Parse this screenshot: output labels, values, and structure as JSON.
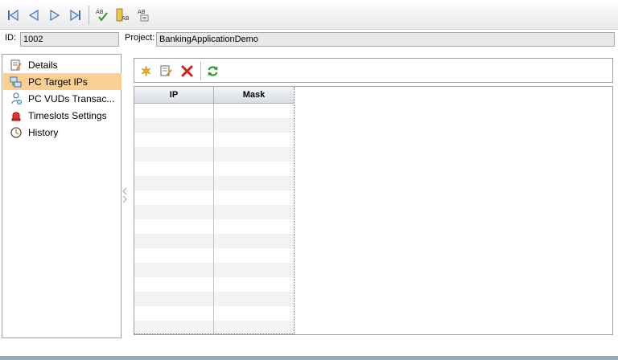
{
  "toolbar": {
    "buttons": [
      {
        "name": "first-record-button",
        "icon": "first-record-icon"
      },
      {
        "name": "previous-record-button",
        "icon": "previous-record-icon"
      },
      {
        "name": "next-record-button",
        "icon": "next-record-icon"
      },
      {
        "name": "last-record-button",
        "icon": "last-record-icon"
      },
      {
        "name": "spell-check-button",
        "icon": "spell-check-icon"
      },
      {
        "name": "thesaurus-button",
        "icon": "thesaurus-icon"
      },
      {
        "name": "spelling-options-button",
        "icon": "spelling-options-icon"
      }
    ]
  },
  "record": {
    "id_label": "ID:",
    "id_value": "1002",
    "project_label": "Project:",
    "project_value": "BankingApplicationDemo"
  },
  "sidebar": {
    "items": [
      {
        "label": "Details",
        "icon": "details-icon",
        "selected": false
      },
      {
        "label": "PC Target IPs",
        "icon": "target-ips-icon",
        "selected": true
      },
      {
        "label": "PC VUDs Transac...",
        "icon": "vuds-transactions-icon",
        "selected": false
      },
      {
        "label": "Timeslots Settings",
        "icon": "alarm-bell-icon",
        "selected": false
      },
      {
        "label": "History",
        "icon": "history-icon",
        "selected": false
      }
    ]
  },
  "main_toolbar": {
    "buttons": [
      {
        "name": "new-button",
        "icon": "new-star-icon"
      },
      {
        "name": "edit-button",
        "icon": "edit-icon"
      },
      {
        "name": "delete-button",
        "icon": "delete-x-icon"
      },
      {
        "name": "refresh-button",
        "icon": "refresh-icon"
      }
    ]
  },
  "grid": {
    "columns": [
      "IP",
      "Mask"
    ],
    "rows": []
  },
  "colors": {
    "selected_item": "#fbcf91",
    "delete_red": "#d42020",
    "refresh_green": "#2e9a2e",
    "new_star_yellow": "#f2b600"
  }
}
